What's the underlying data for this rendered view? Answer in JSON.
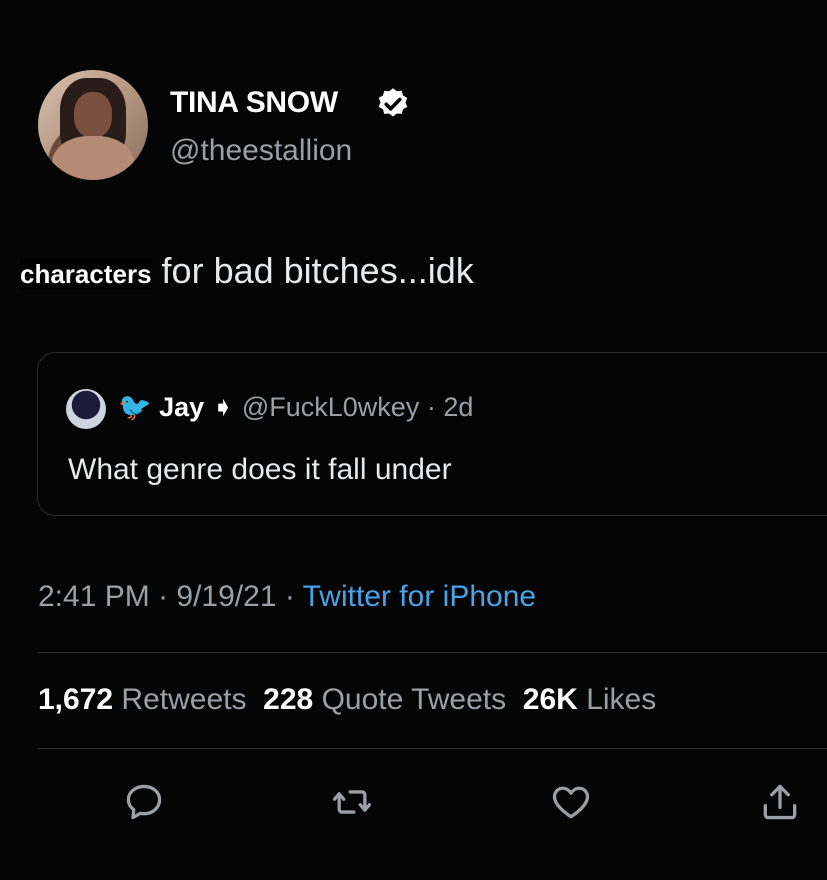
{
  "tweet": {
    "author_name": "TINA SNOW",
    "author_handle": "@theestallion",
    "text_bold": "characters",
    "text_rest": " for bad bitches...idk"
  },
  "quote": {
    "bird": "🐦",
    "name": "Jay",
    "handle": "@FuckL0wkey · 2d",
    "text": "What genre does it fall under"
  },
  "meta": {
    "time": "2:41 PM",
    "date": "9/19/21",
    "source": "Twitter for iPhone",
    "sep": " · "
  },
  "stats": {
    "retweets_count": "1,672",
    "retweets_label": "Retweets",
    "quotes_count": "228",
    "quotes_label": "Quote Tweets",
    "likes_count": "26K",
    "likes_label": "Likes"
  },
  "icons": {
    "verified": "verified-badge-icon",
    "reply": "reply-icon",
    "retweet": "retweet-icon",
    "like": "heart-icon",
    "share": "share-icon"
  },
  "colors": {
    "background": "#050505",
    "link": "#4aa3e8",
    "muted": "#9aa0a6"
  }
}
